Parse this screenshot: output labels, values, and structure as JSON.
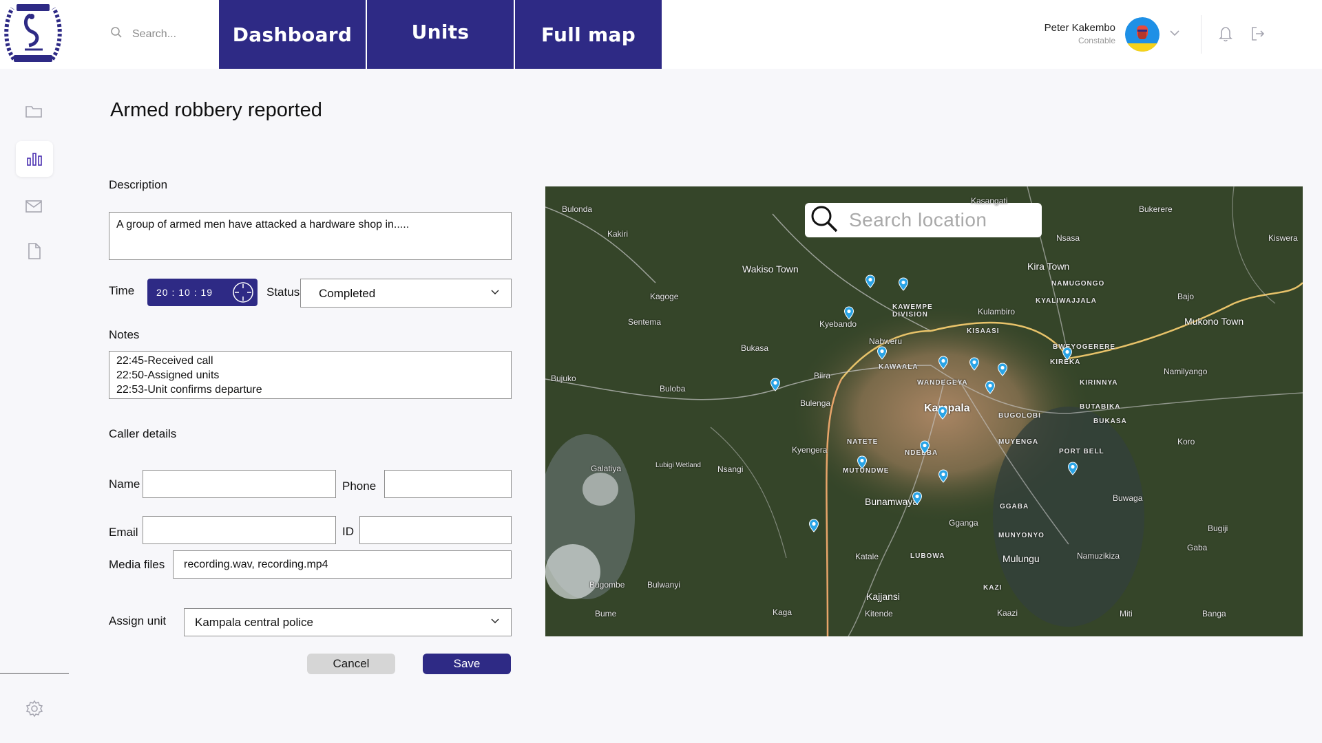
{
  "header": {
    "search_placeholder": "Search...",
    "tabs": [
      {
        "label": "Dashboard"
      },
      {
        "label": "Units"
      },
      {
        "label": "Full map"
      }
    ],
    "user": {
      "name": "Peter Kakembo",
      "role": "Constable"
    }
  },
  "sidebar": {
    "items": [
      {
        "icon": "folder-icon"
      },
      {
        "icon": "bar-chart-icon",
        "active": true
      },
      {
        "icon": "mail-icon"
      },
      {
        "icon": "document-icon"
      }
    ],
    "settings_icon": "gear-icon"
  },
  "incident": {
    "title": "Armed robbery reported",
    "description_label": "Description",
    "description": "A group of armed men have attacked a hardware shop in.....",
    "time_label": "Time",
    "time": "20 : 10 : 19",
    "status_label": "Status",
    "status": "Completed",
    "notes_label": "Notes",
    "notes": [
      "22:45-Received call",
      "22:50-Assigned units",
      "22:53-Unit confirms departure"
    ],
    "caller_label": "Caller details",
    "name_label": "Name",
    "name": "",
    "phone_label": "Phone",
    "phone": "",
    "email_label": "Email",
    "email": "",
    "id_label": "ID",
    "id": "",
    "media_label": "Media files",
    "media": "recording.wav, recording.mp4",
    "assign_label": "Assign unit",
    "assign": "Kampala central police",
    "cancel": "Cancel",
    "save": "Save"
  },
  "map": {
    "search_placeholder": "Search location",
    "labels": {
      "bulonda": "Bulonda",
      "kakiri": "Kakiri",
      "kasangati": "Kasangati",
      "bukerere": "Bukerere",
      "nsasa": "Nsasa",
      "kiswera": "Kiswera",
      "wakiso": "Wakiso Town",
      "kira": "Kira Town",
      "namugongo": "NAMUGONGO",
      "kyaliwajjala": "KYALIWAJJALA",
      "kagoge": "Kagoge",
      "bajo": "Bajo",
      "mukono": "Mukono Town",
      "sentema": "Sentema",
      "kulambiro": "Kulambiro",
      "kisaasi": "KISAASI",
      "kawempe": "KAWEMPE DIVISION",
      "kyebando": "Kyebando",
      "nabweru": "Nabweru",
      "bukasa": "Bukasa",
      "kawaala": "KAWAALA",
      "bweyogerere": "BWEYOGERERE",
      "namilyango": "Namilyango",
      "biira": "Biira",
      "bujuko": "Bujuko",
      "buloba": "Buloba",
      "wandegeya": "WANDEGEYA",
      "kireka": "KIREKA",
      "kirinnya": "KIRINNYA",
      "kampala": "Kampala",
      "bulenga": "Bulenga",
      "butabika": "BUTABIKA",
      "bugolobi": "BUGOLOBI",
      "bukasa2": "BUKASA",
      "natete": "NATETE",
      "muyenga": "MUYENGA",
      "koro": "Koro",
      "kyengera": "Kyengera",
      "ndeeba": "NDEEBA",
      "port_bell": "PORT BELL",
      "galatiya": "Galatiya",
      "lubigi": "Lubigi Wetland",
      "nsangi": "Nsangi",
      "mutundwe": "MUTUNDWE",
      "bunamwaya": "Bunamwaya",
      "buwaga": "Buwaga",
      "ggaba": "GGABA",
      "gganga": "Gganga",
      "bugiji": "Bugiji",
      "munyonyo": "MUNYONYO",
      "gaba": "Gaba",
      "katale": "Katale",
      "lubowa": "LUBOWA",
      "mulungu": "Mulungu",
      "namuzikiza": "Namuzikiza",
      "bugombe": "Bugombe",
      "bulwanyi": "Bulwanyi",
      "kazi": "KAZI",
      "kajjansi": "Kajjansi",
      "bume": "Bume",
      "kaga": "Kaga",
      "kitende": "Kitende",
      "kaazi": "Kaazi",
      "miti": "Miti",
      "banga": "Banga"
    }
  },
  "colors": {
    "primary": "#2e2a85",
    "map_pin": "#2aa4e6"
  }
}
